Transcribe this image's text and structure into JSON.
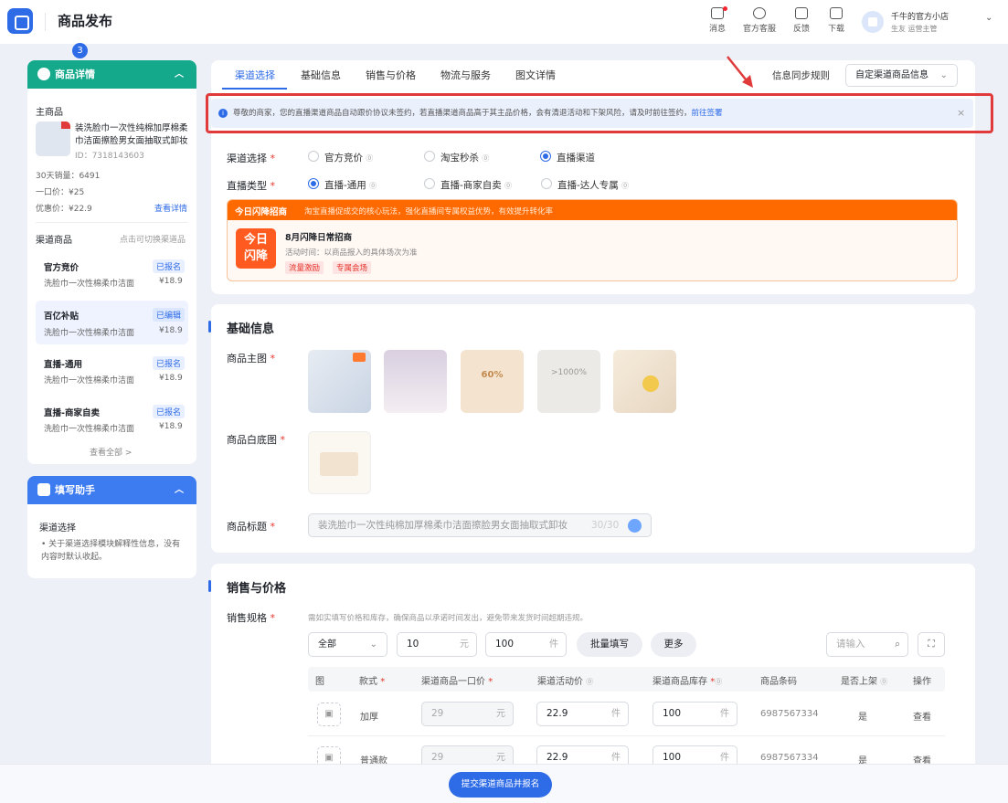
{
  "header": {
    "title": "商品发布",
    "icons": [
      {
        "label": "消息",
        "name": "message-icon"
      },
      {
        "label": "官方客服",
        "name": "support-icon"
      },
      {
        "label": "反馈",
        "name": "feedback-icon"
      },
      {
        "label": "下载",
        "name": "download-icon"
      }
    ],
    "shop_name": "千牛的官方小店",
    "shop_role": "生友  运营主管",
    "step_badge": "3"
  },
  "left": {
    "detail_title": "商品详情",
    "main_product_label": "主商品",
    "product_name": "装洗脸巾一次性纯棉加厚棉柔巾洁面擦脸男女面抽取式卸妆",
    "product_id": "ID：7318143603",
    "sales": "30天销量：6491",
    "price": "一口价：¥25",
    "discount": "优惠价：¥22.9",
    "view_detail": "查看详情",
    "channel_label": "渠道商品",
    "channel_hint": "点击可切换渠道品",
    "channels": [
      {
        "name": "官方竞价",
        "status": "已报名",
        "desc": "洗脸巾一次性棉柔巾洁面",
        "price": "¥18.9"
      },
      {
        "name": "百亿补贴",
        "status": "已编辑",
        "desc": "洗脸巾一次性棉柔巾洁面",
        "price": "¥18.9"
      },
      {
        "name": "直播-通用",
        "status": "已报名",
        "desc": "洗脸巾一次性棉柔巾洁面",
        "price": "¥18.9"
      },
      {
        "name": "直播-商家自卖",
        "status": "已报名",
        "desc": "洗脸巾一次性棉柔巾洁面",
        "price": "¥18.9"
      }
    ],
    "view_all": "查看全部 >",
    "helper_title": "填写助手",
    "helper_sub": "渠道选择",
    "helper_text": "关于渠道选择模块解释性信息，没有内容时默认收起。"
  },
  "tabs": [
    "渠道选择",
    "基础信息",
    "销售与价格",
    "物流与服务",
    "图文详情"
  ],
  "sync_label": "信息同步规则",
  "sync_select": "自定渠道商品信息",
  "notice": {
    "text": "尊敬的商家，您的直播渠道商品自动跟价协议未签约，若直播渠道商品高于其主品价格，会有清退活动和下架风险，请及时前往签约，",
    "link": "前往签署"
  },
  "channel_select": {
    "label": "渠道选择",
    "options": [
      "官方竞价",
      "淘宝秒杀",
      "直播渠道"
    ],
    "selected": 2
  },
  "live_type": {
    "label": "直播类型",
    "options": [
      "直播-通用",
      "直播-商家自卖",
      "直播-达人专属"
    ],
    "selected": 0
  },
  "promo": {
    "title": "今日闪降招商",
    "subtitle": "淘宝直播促成交的核心玩法，强化直播间专属权益优势，有效提升转化率",
    "badge_line1": "今日",
    "badge_line2": "闪降",
    "name": "8月闪降日常招商",
    "time": "活动时间：以商品报入的具体场次为准",
    "tags": [
      "流量激励",
      "专属会场"
    ]
  },
  "basic": {
    "title": "基础信息",
    "main_image_label": "商品主图",
    "white_image_label": "商品白底图",
    "title_label": "商品标题",
    "title_value": "装洗脸巾一次性纯棉加厚棉柔巾洁面擦脸男女面抽取式卸妆",
    "title_count": "30/30",
    "img_texts": [
      "",
      "",
      "60%",
      ">1000%",
      ""
    ]
  },
  "sales": {
    "title": "销售与价格",
    "spec_label": "销售规格",
    "spec_hint": "需如实填写价格和库存，确保商品以承诺时间发出，避免带来发货时间超期违规。",
    "filter": "全部",
    "qty": "10",
    "qty_unit": "元",
    "price": "100",
    "price_unit": "件",
    "batch_btn": "批量填写",
    "more_btn": "更多",
    "search_placeholder": "请输入",
    "columns": [
      "图",
      "款式",
      "渠道商品一口价",
      "渠道活动价",
      "渠道商品库存",
      "商品条码",
      "是否上架",
      "操作"
    ],
    "rows": [
      {
        "style": "加厚",
        "list_price": "29",
        "list_unit": "元",
        "act_price": "22.9",
        "act_unit": "件",
        "stock": "100",
        "stock_unit": "件",
        "barcode": "6987567334",
        "on_shelf": "是",
        "action": "查看"
      },
      {
        "style": "普通款",
        "list_price": "29",
        "list_unit": "元",
        "act_price": "22.9",
        "act_unit": "件",
        "stock": "100",
        "stock_unit": "件",
        "barcode": "6987567334",
        "on_shelf": "是",
        "action": "查看"
      }
    ]
  },
  "submit": "提交渠道商品并报名"
}
